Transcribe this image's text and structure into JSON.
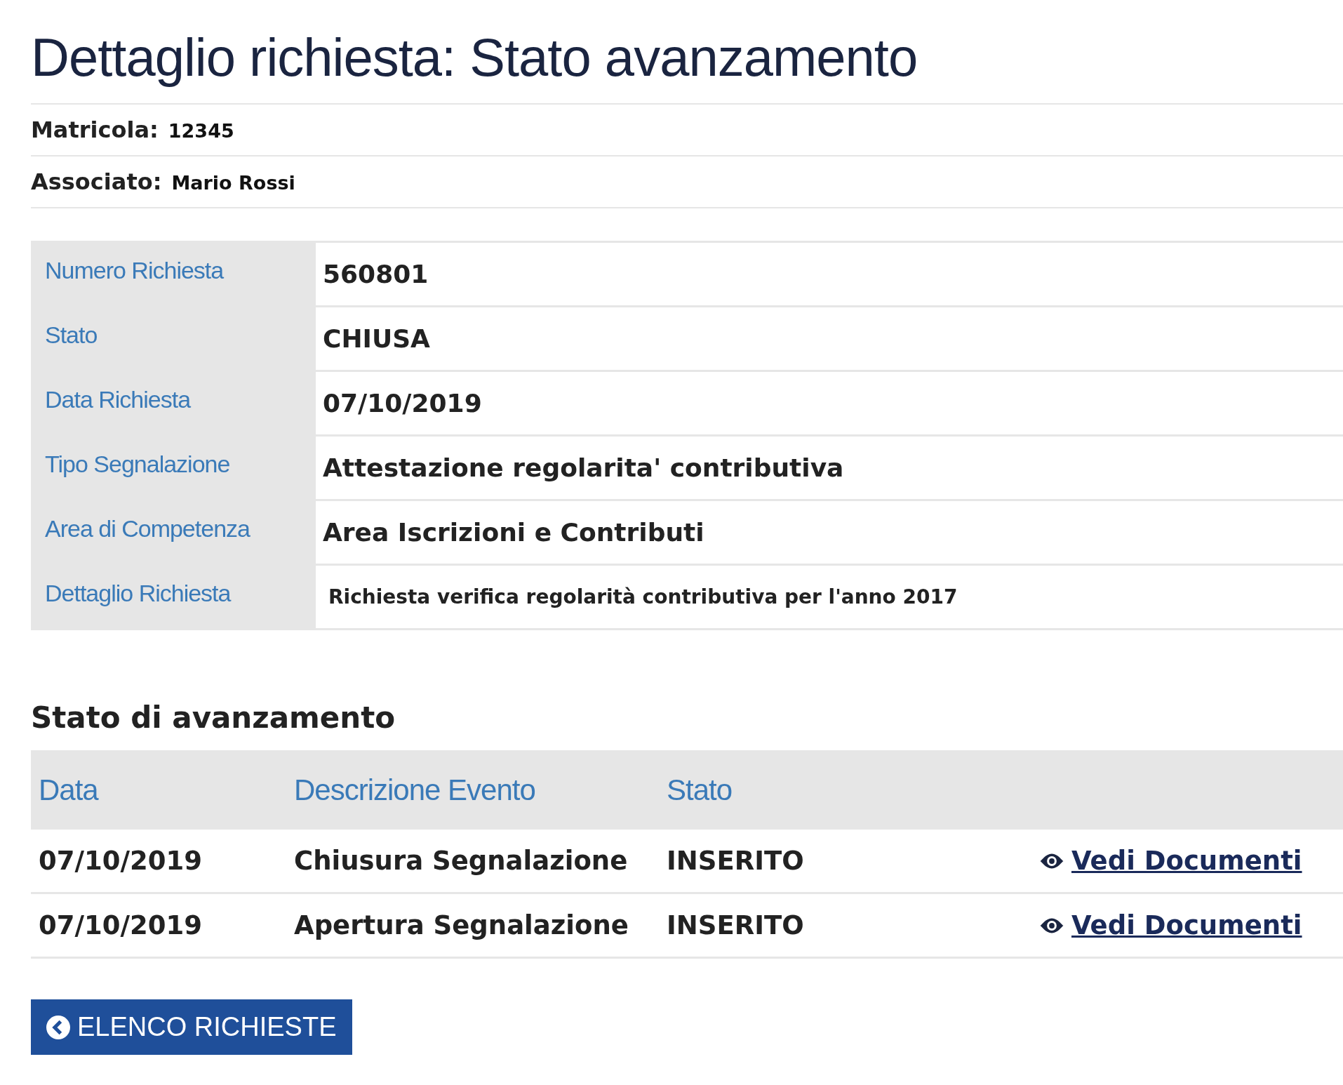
{
  "title": "Dettaglio richiesta: Stato avanzamento",
  "info": [
    {
      "label": "Matricola:",
      "value": "12345"
    },
    {
      "label": "Associato:",
      "value": "Mario Rossi"
    }
  ],
  "details": [
    {
      "label": "Numero Richiesta",
      "value": "560801",
      "kind": "normal"
    },
    {
      "label": "Stato",
      "value": "CHIUSA",
      "kind": "normal"
    },
    {
      "label": "Data Richiesta",
      "value": "07/10/2019",
      "kind": "normal"
    },
    {
      "label": "Tipo Segnalazione",
      "value": "Attestazione regolarita' contributiva",
      "kind": "normal"
    },
    {
      "label": "Area di Competenza",
      "value": "Area Iscrizioni e Contributi",
      "kind": "normal"
    },
    {
      "label": "Dettaglio Richiesta",
      "value": "Richiesta verifica regolarità contributiva per l'anno 2017",
      "kind": "small"
    }
  ],
  "progress": {
    "title": "Stato di avanzamento",
    "columns": [
      "Data",
      "Descrizione Evento",
      "Stato"
    ],
    "rows": [
      {
        "date": "07/10/2019",
        "event": "Chiusura Segnalazione",
        "status": "INSERITO",
        "link": "Vedi Documenti"
      },
      {
        "date": "07/10/2019",
        "event": "Apertura Segnalazione",
        "status": "INSERITO",
        "link": "Vedi Documenti"
      }
    ]
  },
  "back_button": "ELENCO RICHIESTE"
}
